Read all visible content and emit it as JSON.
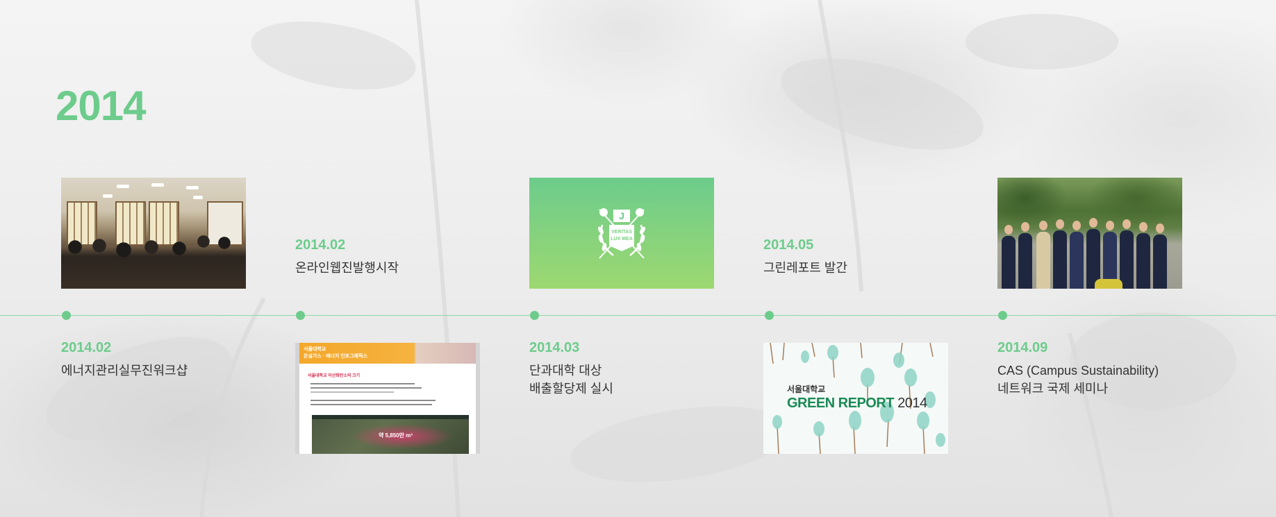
{
  "year": "2014",
  "colors": {
    "accent": "#6dcc8c",
    "axis": "#8fd7a6",
    "text": "#333333"
  },
  "events": [
    {
      "date": "2014.02",
      "desc": "에너지관리실무진워크샵"
    },
    {
      "date": "2014.02",
      "desc": "온라인웹진발행시작"
    },
    {
      "date": "2014.03",
      "desc": "단과대학 대상\n배출할당제 실시"
    },
    {
      "date": "2014.05",
      "desc": "그린레포트 발간"
    },
    {
      "date": "2014.09",
      "desc": "CAS (Campus Sustainability)\n네트워크 국제 세미나"
    }
  ],
  "thumbs": {
    "logo": {
      "motto_line1": "VERITAS",
      "motto_line2": "LUX MEA"
    },
    "infographic": {
      "title_line1": "서울대학교",
      "title_line2": "온실가스 · 에너지 인포그래픽스",
      "heading": "서울대학교 이산화탄소의 크기",
      "map_label": "약 5,850만 m³"
    },
    "green_report": {
      "org": "서울대학교",
      "title": "GREEN REPORT",
      "year": "2014"
    }
  }
}
